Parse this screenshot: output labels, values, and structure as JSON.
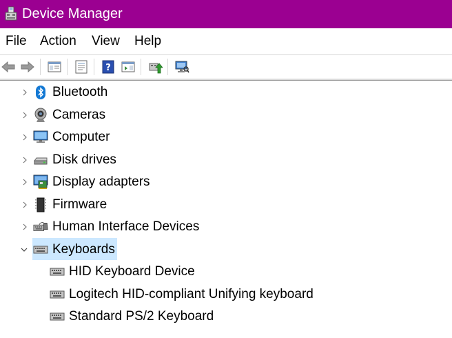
{
  "window": {
    "title": "Device Manager"
  },
  "menu": {
    "items": [
      "File",
      "Action",
      "View",
      "Help"
    ]
  },
  "tree": {
    "categories": [
      {
        "label": "Bluetooth",
        "icon": "bluetooth-icon",
        "expanded": false
      },
      {
        "label": "Cameras",
        "icon": "camera-icon",
        "expanded": false
      },
      {
        "label": "Computer",
        "icon": "computer-icon",
        "expanded": false
      },
      {
        "label": "Disk drives",
        "icon": "disk-drive-icon",
        "expanded": false
      },
      {
        "label": "Display adapters",
        "icon": "display-adapter-icon",
        "expanded": false
      },
      {
        "label": "Firmware",
        "icon": "firmware-icon",
        "expanded": false
      },
      {
        "label": "Human Interface Devices",
        "icon": "hid-icon",
        "expanded": false
      },
      {
        "label": "Keyboards",
        "icon": "keyboard-icon",
        "expanded": true,
        "selected": true
      }
    ],
    "keyboards_children": [
      "HID Keyboard Device",
      "Logitech HID-compliant Unifying keyboard",
      "Standard PS/2 Keyboard"
    ]
  },
  "colors": {
    "titlebar": "#9b0091",
    "selection": "#cce8ff",
    "bluetooth": "#1479d4"
  }
}
